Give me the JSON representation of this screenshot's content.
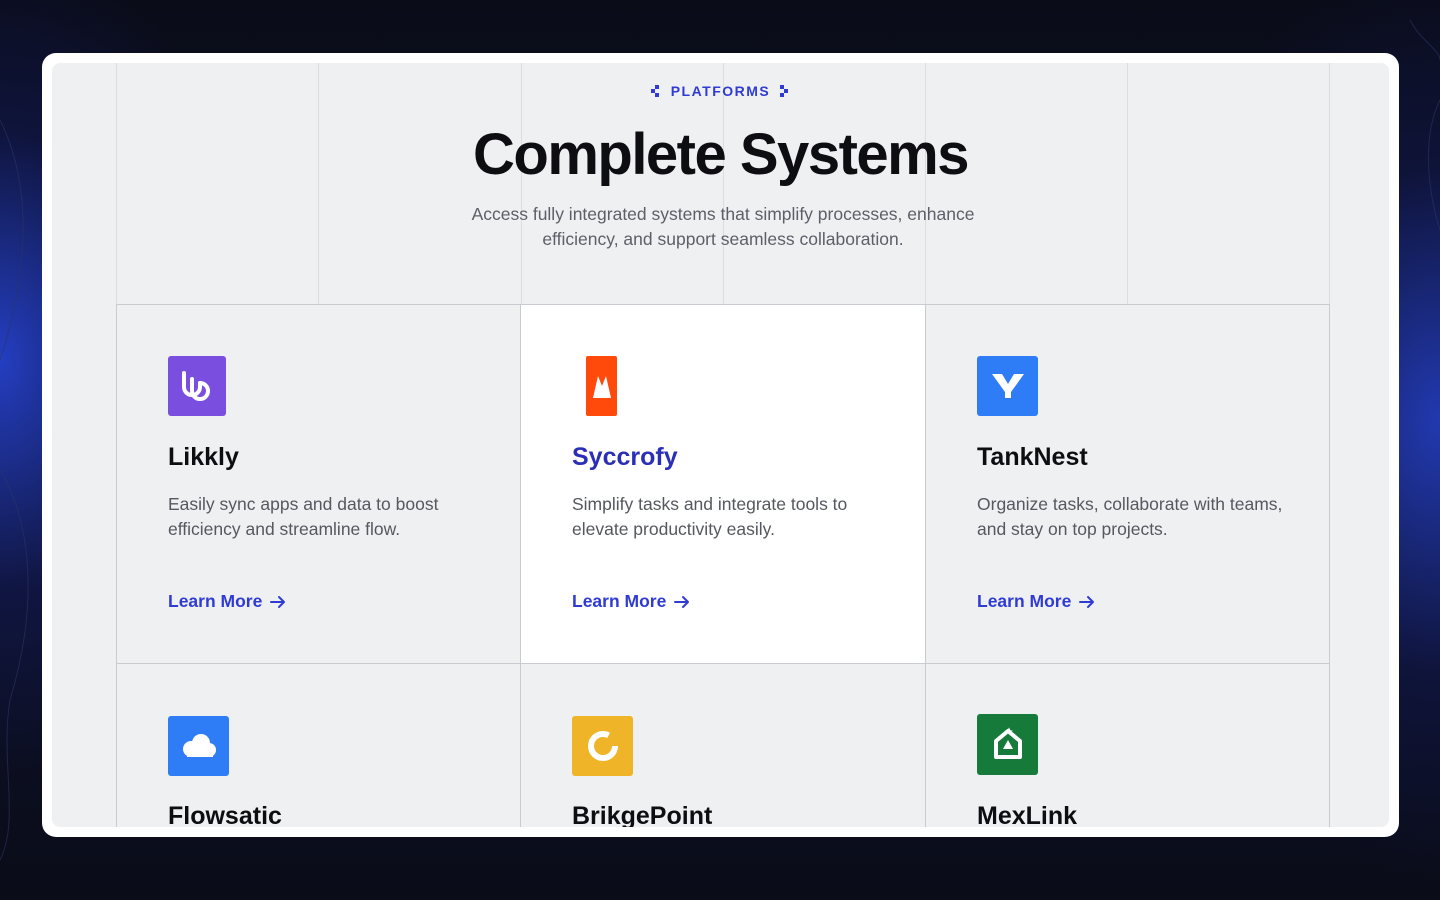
{
  "section": {
    "eyebrow": "PLATFORMS",
    "title": "Complete Systems",
    "subtitle": "Access fully integrated systems that simplify processes, enhance efficiency, and support seamless collaboration."
  },
  "cards": [
    {
      "name": "Likkly",
      "description": "Easily sync apps and data to boost efficiency and streamline flow.",
      "link": "Learn More",
      "logo_color": "#7a4fdf",
      "icon": "likkly-logo-icon"
    },
    {
      "name": "Syccrofy",
      "description": "Simplify tasks and integrate tools to elevate productivity easily.",
      "link": "Learn More",
      "logo_color": "#ff4a0c",
      "icon": "syccrofy-logo-icon"
    },
    {
      "name": "TankNest",
      "description": "Organize tasks, collaborate with teams, and stay on top projects.",
      "link": "Learn More",
      "logo_color": "#2f7df6",
      "icon": "tanknest-logo-icon"
    },
    {
      "name": "Flowsatic",
      "logo_color": "#2f7df6",
      "icon": "flowsatic-cloud-logo-icon"
    },
    {
      "name": "BrikgePoint",
      "logo_color": "#f0b429",
      "icon": "brikgepoint-ring-logo-icon"
    },
    {
      "name": "MexLink",
      "logo_color": "#167a3a",
      "icon": "mexlink-logo-icon"
    }
  ],
  "colors": {
    "accent": "#2f3bd3",
    "active_title": "#2a2fb5",
    "panel_bg": "#eff0f2"
  }
}
